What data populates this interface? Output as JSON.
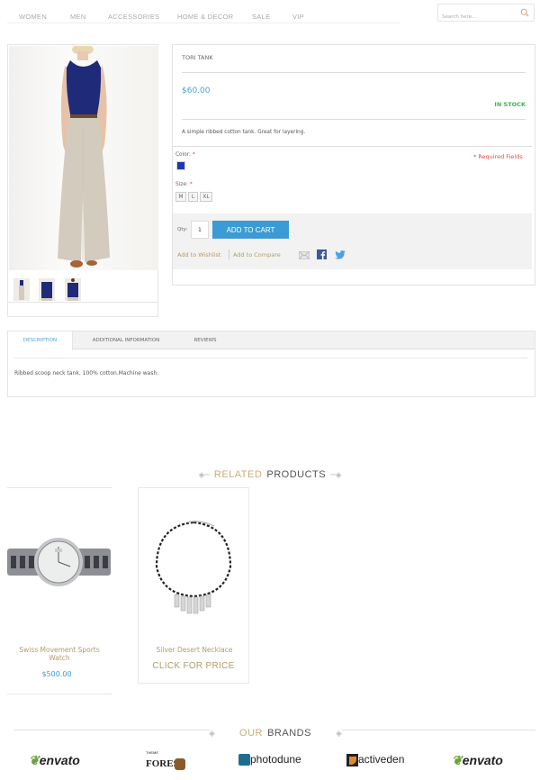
{
  "nav": {
    "items": [
      "WOMEN",
      "MEN",
      "ACCESSORIES",
      "HOME & DECOR",
      "SALE",
      "VIP"
    ],
    "search_placeholder": "Search here..."
  },
  "product": {
    "name": "TORI TANK",
    "price": "$60.00",
    "availability": "IN STOCK",
    "short_description": "A simple ribbed cotton tank. Great for layering.",
    "color_label": "Color:",
    "required_mark": "*",
    "required_fields": "* Required Fields",
    "selected_color": "#1f3aa8",
    "size_label": "Size:",
    "sizes": [
      "M",
      "L",
      "XL"
    ],
    "qty_label": "Qty:",
    "qty_value": "1",
    "add_to_cart": "ADD TO CART",
    "add_to_wishlist": "Add to Wishlist",
    "add_to_compare": "Add to Compare",
    "thumbnail_count": 3
  },
  "tabs": {
    "items": [
      "DESCRIPTION",
      "ADDITIONAL INFORMATION",
      "REVIEWS"
    ],
    "active": "DESCRIPTION",
    "description_text": "Ribbed scoop neck tank. 100% cotton.Machine wash."
  },
  "related": {
    "title_highlight": "RELATED",
    "title_rest": "PRODUCTS",
    "products": [
      {
        "name": "Swiss Movement Sports Watch",
        "price": "$500.00"
      },
      {
        "name": "Silver Desert Necklace",
        "price_cta": "CLICK FOR PRICE"
      }
    ]
  },
  "brands": {
    "title_highlight": "OUR",
    "title_rest": "BRANDS",
    "items": [
      "envato",
      "FOREST",
      "photodune",
      "activeden",
      "envato"
    ],
    "themeforest_small": "THEME"
  },
  "colors": {
    "accent_blue": "#3a9bd5",
    "gold": "#b39b6b",
    "in_stock_green": "#3cb54a",
    "required_red": "#e34b4b"
  }
}
